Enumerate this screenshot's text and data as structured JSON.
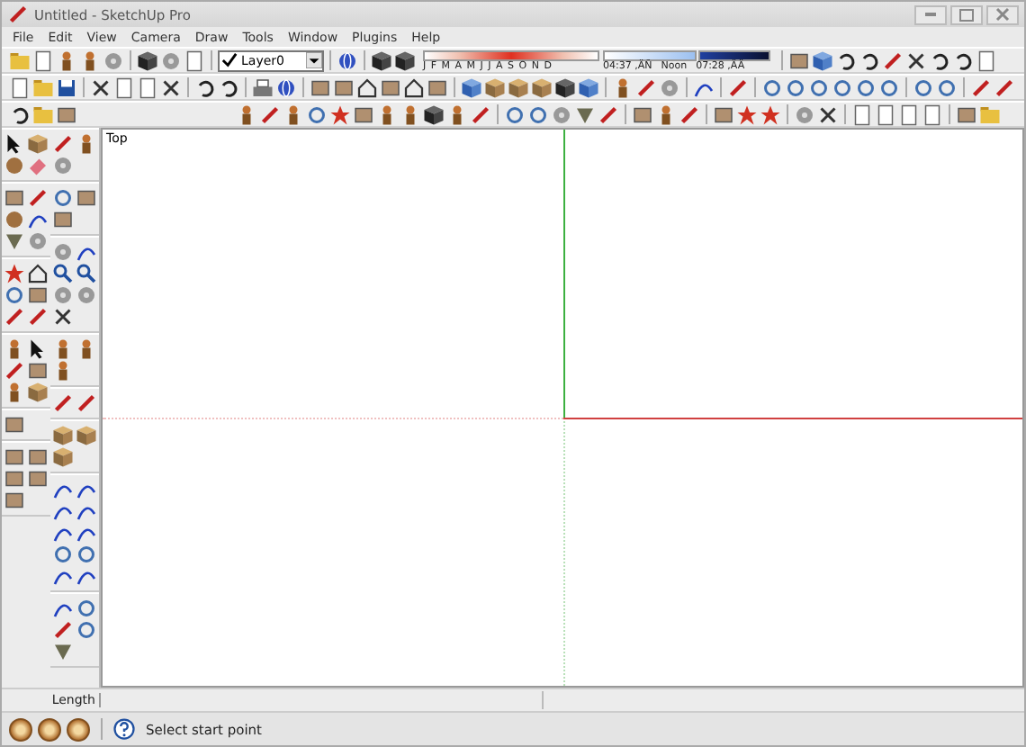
{
  "window": {
    "title": "Untitled - SketchUp Pro"
  },
  "menu": [
    "File",
    "Edit",
    "View",
    "Camera",
    "Draw",
    "Tools",
    "Window",
    "Plugins",
    "Help"
  ],
  "layer_dropdown": {
    "value": "Layer0"
  },
  "shadow_settings": {
    "months": "J F M A M J J A S O N D",
    "times": [
      "04:37 ,ÄÑ",
      "Noon",
      "07:28 ,ÄÄ"
    ]
  },
  "viewport": {
    "view_label": "Top"
  },
  "measurements": {
    "label": "Length"
  },
  "status_bar": {
    "text": "Select start point"
  }
}
